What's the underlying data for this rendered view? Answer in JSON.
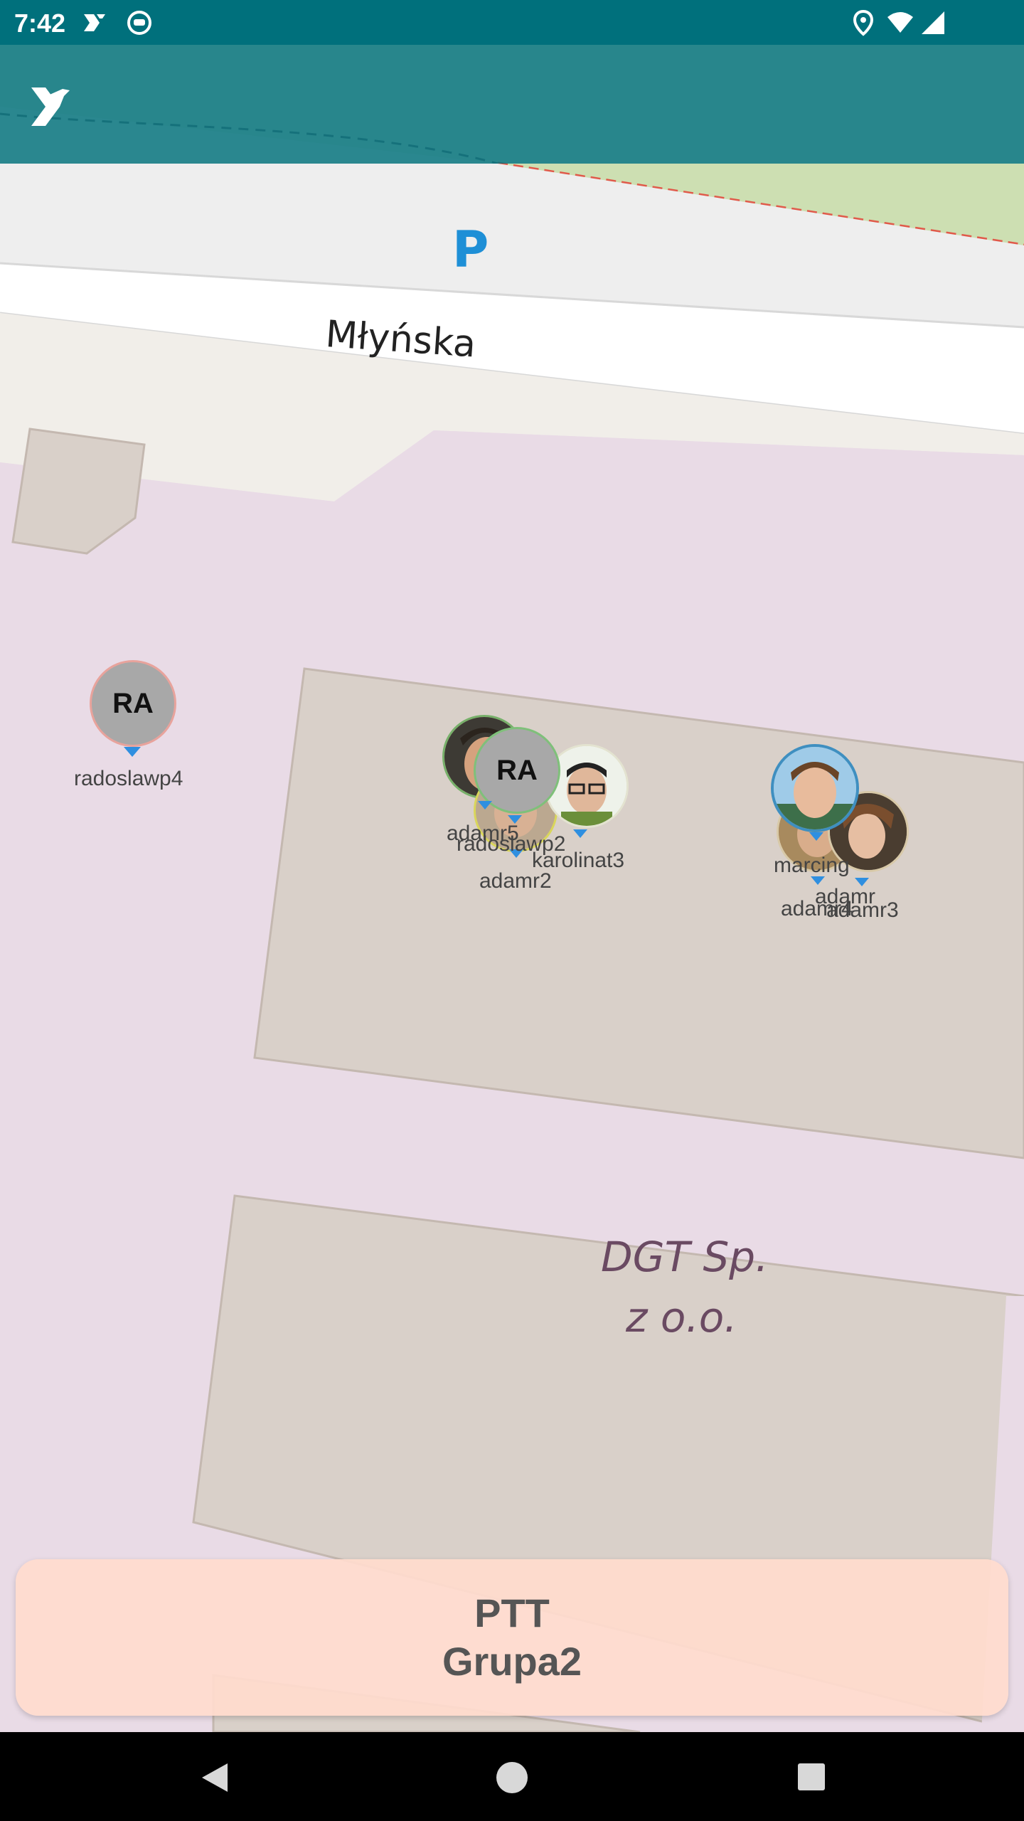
{
  "status_bar": {
    "time": "7:42",
    "icons": [
      "cast-icon",
      "app-notification-icon",
      "location-icon",
      "wifi-icon",
      "signal-icon"
    ]
  },
  "app_bar": {
    "logo": "app-logo-menu-icon"
  },
  "map": {
    "parking_label": "P",
    "street_name": "Młyńska",
    "poi_line1": "DGT Sp.",
    "poi_line2": "z o.o."
  },
  "markers": [
    {
      "user": "radoslawp4",
      "initials": "RA"
    },
    {
      "user": "adamr5"
    },
    {
      "user": "radoslawp2",
      "initials": "RA"
    },
    {
      "user": "adamr2"
    },
    {
      "user": "karolinat3"
    },
    {
      "user": "marcing"
    },
    {
      "user": "adamr"
    },
    {
      "user": "adamr4"
    },
    {
      "user": "adamr3"
    }
  ],
  "ptt": {
    "line1": "PTT",
    "line2": "Grupa2"
  },
  "colors": {
    "status_bar": "#00707c",
    "map_pink": "#e9dbe6",
    "building": "#d9d0c9",
    "ptt_bg": "#ffdccd"
  }
}
